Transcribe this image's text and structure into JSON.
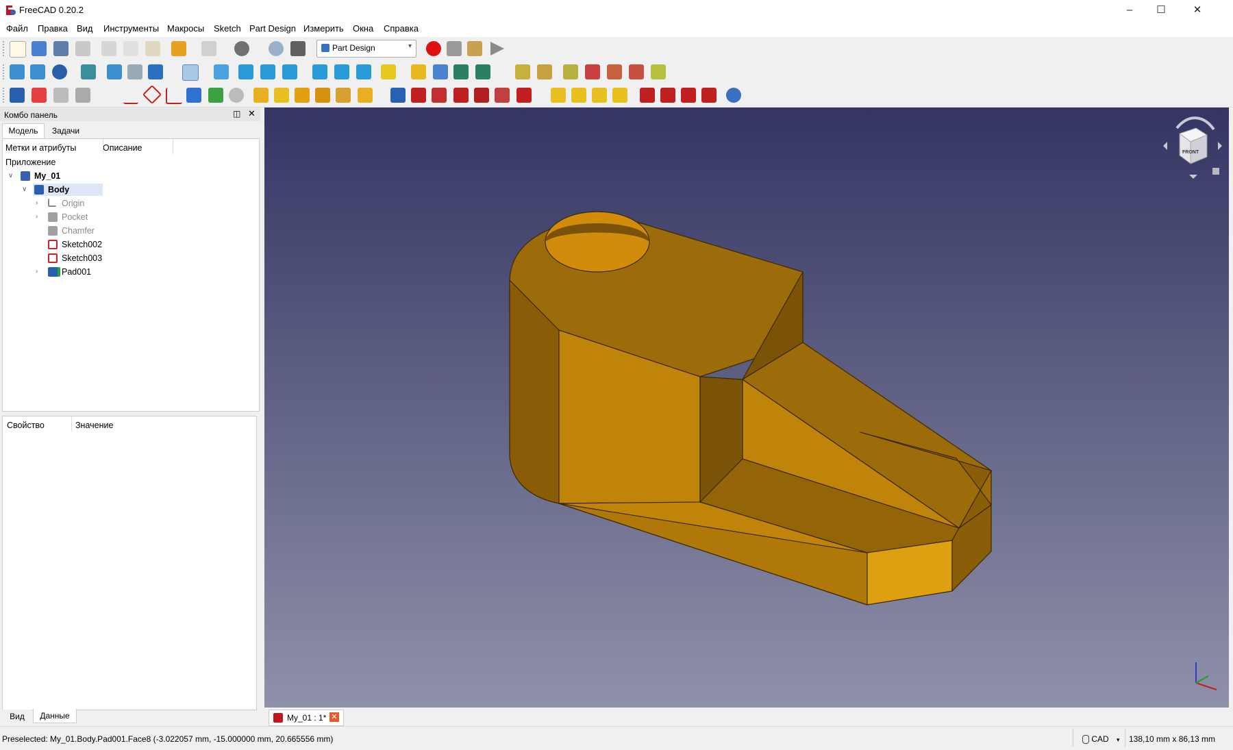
{
  "window": {
    "title": "FreeCAD 0.20.2"
  },
  "menu": [
    "Файл",
    "Правка",
    "Вид",
    "Инструменты",
    "Макросы",
    "Sketch",
    "Part Design",
    "Измерить",
    "Окна",
    "Справка"
  ],
  "toolbar": {
    "workbench_select": "Part Design"
  },
  "combo_panel": {
    "title": "Комбо панель",
    "tabs": [
      "Модель",
      "Задачи"
    ],
    "tree_headers": [
      "Метки и атрибуты",
      "Описание"
    ],
    "tree_root": "Приложение",
    "tree_items": [
      {
        "label": "My_01"
      },
      {
        "label": "Body"
      },
      {
        "label": "Origin"
      },
      {
        "label": "Pocket"
      },
      {
        "label": "Chamfer"
      },
      {
        "label": "Sketch002"
      },
      {
        "label": "Sketch003"
      },
      {
        "label": "Pad001"
      }
    ],
    "prop_headers": [
      "Свойство",
      "Значение"
    ],
    "bottom_tabs": [
      "Вид",
      "Данные"
    ]
  },
  "document_tab": {
    "label": "My_01 : 1*"
  },
  "navcube": {
    "face_label": "FRONT"
  },
  "status": {
    "preselected": "Preselected: My_01.Body.Pad001.Face8 (-3.022057 mm, -15.000000 mm, 20.665556 mm)",
    "nav_style": "CAD",
    "dimensions": "138,10 mm x 86,13 mm"
  },
  "colors": {
    "accent": "#2b6cd6",
    "part": "#c8870a",
    "bg_top": "#343563",
    "bg_bottom": "#8f91a9"
  }
}
